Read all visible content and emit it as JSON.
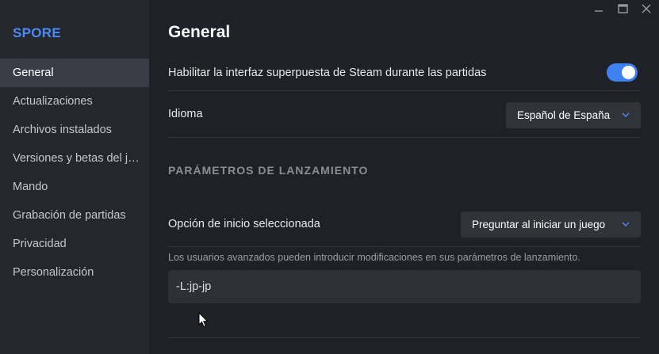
{
  "app": {
    "title": "SPORE"
  },
  "window_controls": [
    {
      "name": "minimize-icon"
    },
    {
      "name": "maximize-icon"
    },
    {
      "name": "close-icon"
    }
  ],
  "sidebar": {
    "items": [
      {
        "label": "General",
        "active": true
      },
      {
        "label": "Actualizaciones"
      },
      {
        "label": "Archivos instalados"
      },
      {
        "label": "Versiones y betas del juego"
      },
      {
        "label": "Mando"
      },
      {
        "label": "Grabación de partidas"
      },
      {
        "label": "Privacidad"
      },
      {
        "label": "Personalización"
      }
    ]
  },
  "main": {
    "title": "General",
    "overlay": {
      "label": "Habilitar la interfaz superpuesta de Steam durante las partidas",
      "enabled": true
    },
    "language": {
      "label": "Idioma",
      "value": "Español de España"
    },
    "launch_section": {
      "header": "PARÁMETROS DE LANZAMIENTO",
      "start_option_label": "Opción de inicio seleccionada",
      "start_option_value": "Preguntar al iniciar un juego",
      "hint": "Los usuarios avanzados pueden introducir modificaciones en sus parámetros de lanzamiento.",
      "params_value": "-L:jp-jp"
    }
  },
  "colors": {
    "accent": "#3d82f0",
    "title_blue": "#4c8bf5",
    "background": "#1f2128",
    "sidebar": "#25272e"
  }
}
